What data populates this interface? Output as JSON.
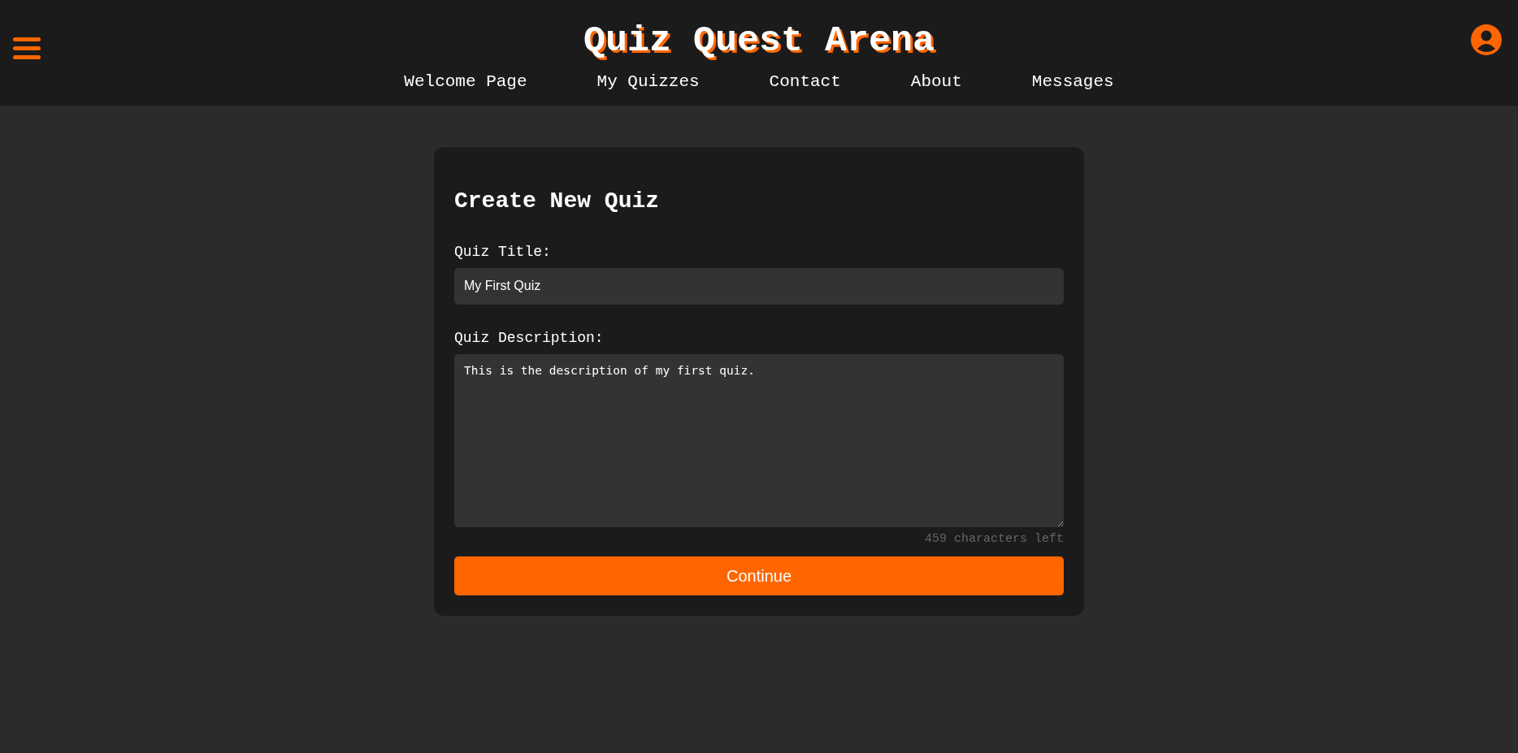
{
  "header": {
    "title": "Quiz Quest Arena"
  },
  "nav": [
    {
      "label": "Welcome Page"
    },
    {
      "label": "My Quizzes"
    },
    {
      "label": "Contact"
    },
    {
      "label": "About"
    },
    {
      "label": "Messages"
    }
  ],
  "form": {
    "heading": "Create New Quiz",
    "title_label": "Quiz Title:",
    "title_value": "My First Quiz",
    "description_label": "Quiz Description:",
    "description_value": "This is the description of my first quiz.",
    "counter": "459 characters left",
    "button": "Continue"
  }
}
